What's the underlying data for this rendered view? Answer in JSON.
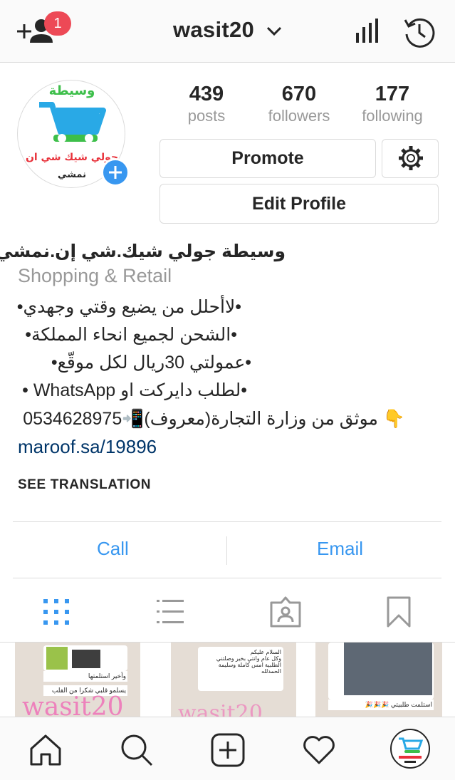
{
  "header": {
    "username": "wasit20",
    "notification_count": "1",
    "icons": [
      "add-user-icon",
      "chevron-down-icon",
      "stats-icon",
      "history-icon"
    ]
  },
  "profile": {
    "avatar": {
      "logo_text_top": "وسيطة",
      "logo_text_mid": "جولي شيك شي ان",
      "logo_text_bottom": "نمشي"
    },
    "stats": [
      {
        "value": "439",
        "label": "posts"
      },
      {
        "value": "670",
        "label": "followers"
      },
      {
        "value": "177",
        "label": "following"
      }
    ],
    "promote_label": "Promote",
    "edit_profile_label": "Edit Profile"
  },
  "bio": {
    "name": "وسيطة جولي شيك.شي إن.نمشي",
    "category": "Shopping & Retail",
    "lines": [
      "•لاأحلل من يضيع وقتي وجهدي•",
      "•الشحن لجميع انحاء المملكة•",
      "•عمولتي 30ريال لكل موقّع•",
      "•لطلب دايركت او WhatsApp •",
      "👇 موثق من وزارة التجارة(معروف)📲0534628975"
    ],
    "link": "maroof.sa/19896",
    "see_translation": "SEE TRANSLATION"
  },
  "contact": {
    "call_label": "Call",
    "email_label": "Email"
  },
  "tabs": [
    "grid-icon",
    "list-icon",
    "tagged-icon",
    "saved-icon"
  ],
  "grid_posts": [
    {
      "caption": "وأخير استلمتها",
      "text2": "يسلمو قلبي شكرا من القلب",
      "watermark": "wasit20"
    },
    {
      "caption": "السلام عليكم",
      "text2": "وكل عام وانتي بخير وصلتني الطلبية امس كاملة وسليمة الحمدلله",
      "watermark": "wasit20"
    },
    {
      "caption": "استلمت طلبيتي 🎉🎉🎉"
    }
  ],
  "bottom_nav": [
    "home-icon",
    "search-icon",
    "new-post-icon",
    "activity-icon",
    "profile-icon"
  ],
  "colors": {
    "accent_blue": "#3897f0",
    "badge_red": "#ed4956",
    "link_blue": "#003569",
    "muted_gray": "#999999",
    "divider": "#dbdbdb"
  }
}
